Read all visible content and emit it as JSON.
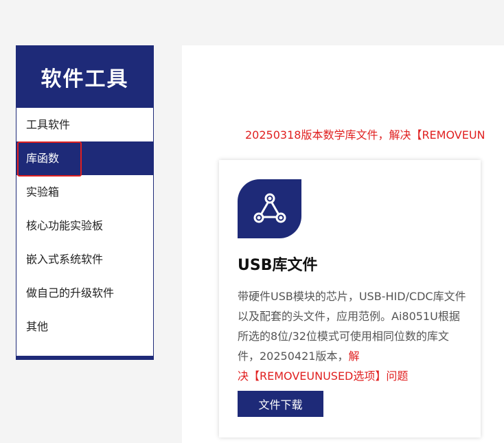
{
  "sidebar": {
    "title": "软件工具",
    "items": [
      {
        "label": "工具软件"
      },
      {
        "label": "库函数"
      },
      {
        "label": "实验箱"
      },
      {
        "label": "核心功能实验板"
      },
      {
        "label": "嵌入式系统软件"
      },
      {
        "label": "做自己的升级软件"
      },
      {
        "label": "其他"
      }
    ],
    "active_index": 1
  },
  "main": {
    "notice": "20250318版本数学库文件，解决【REMOVEUN",
    "card": {
      "icon": "share-nodes-icon",
      "title": "USB库文件",
      "desc_main": "带硬件USB模块的芯片，USB-HID/CDC库文件以及配套的头文件，应用范例。Ai8051U根据所选的8位/32位模式可使用相同位数的库文件，20250421版本，",
      "desc_red_a": "解",
      "desc_red_b": "决【REMOVEUNUSED选项】问题",
      "button_label": "文件下载"
    }
  },
  "colors": {
    "brand": "#1e2a78",
    "alert": "#e02020"
  }
}
